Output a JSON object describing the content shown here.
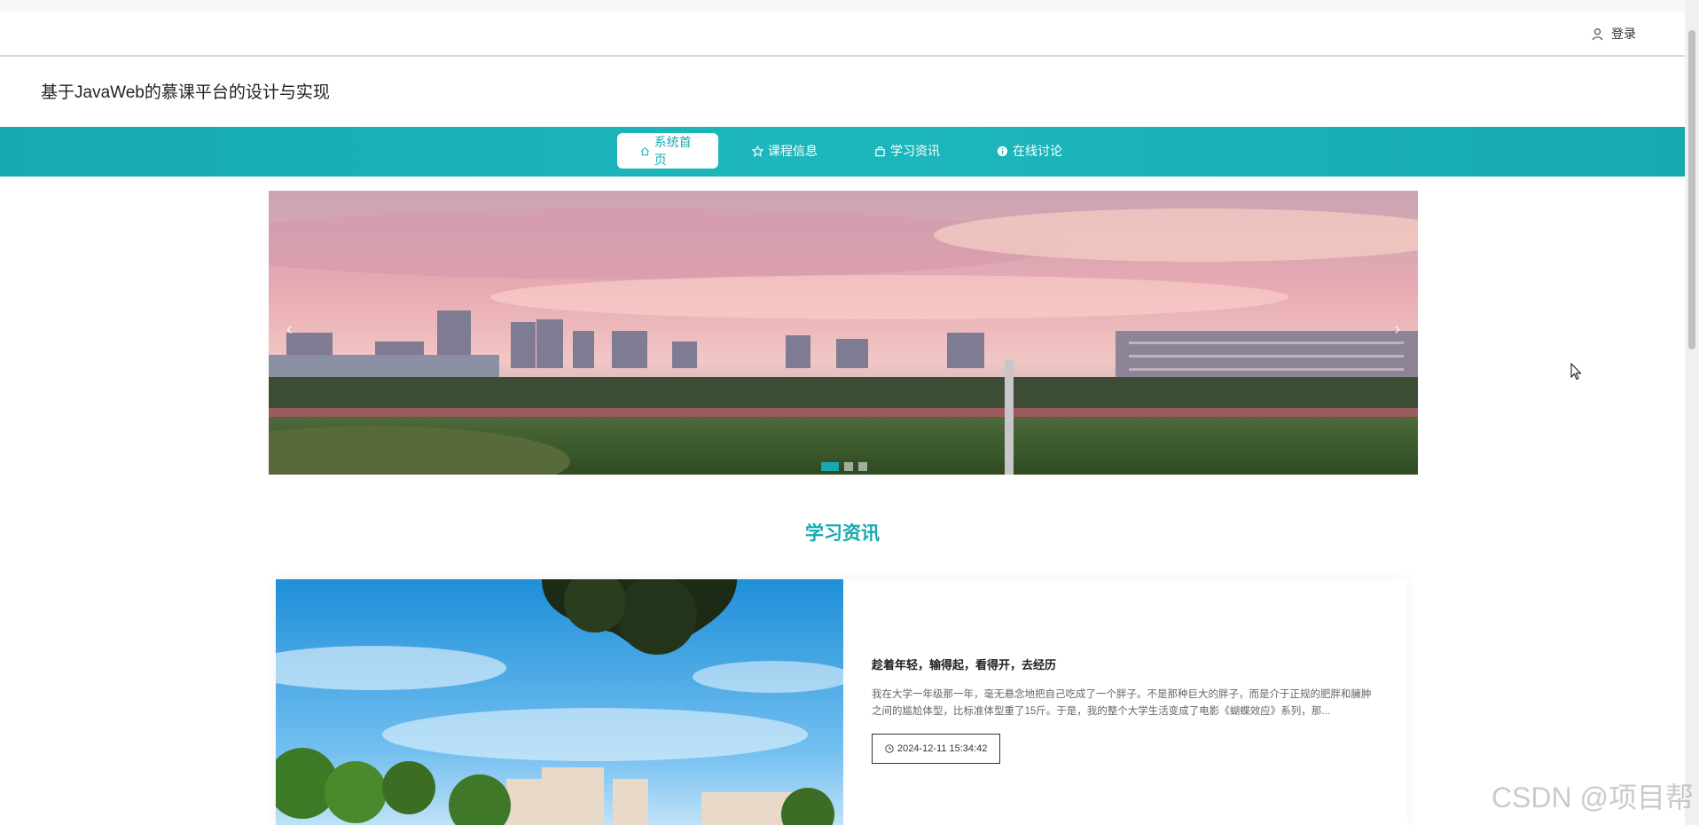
{
  "header": {
    "login_label": "登录",
    "site_title": "基于JavaWeb的慕课平台的设计与实现"
  },
  "nav": {
    "items": [
      {
        "label": "系统首页",
        "icon": "home-icon",
        "active": true
      },
      {
        "label": "课程信息",
        "icon": "star-icon",
        "active": false
      },
      {
        "label": "学习资讯",
        "icon": "bag-icon",
        "active": false
      },
      {
        "label": "在线讨论",
        "icon": "info-circle-icon",
        "active": false
      }
    ]
  },
  "carousel": {
    "prev_label": "‹",
    "next_label": "›",
    "slide_count": 3,
    "active_index": 0
  },
  "section": {
    "title": "学习资讯"
  },
  "news": [
    {
      "title": "趁着年轻，输得起，看得开，去经历",
      "excerpt": "我在大学一年级那一年，毫无悬念地把自己吃成了一个胖子。不是那种巨大的胖子，而是介于正规的肥胖和臃肿之间的尴尬体型，比标准体型重了15斤。于是，我的整个大学生活变成了电影《蝴蝶效应》系列，那...",
      "date": "2024-12-11 15:34:42"
    }
  ],
  "watermark": "CSDN @项目帮",
  "colors": {
    "accent": "#18a9b0",
    "nav_bg": "#1cb8bd",
    "text": "#222222"
  }
}
